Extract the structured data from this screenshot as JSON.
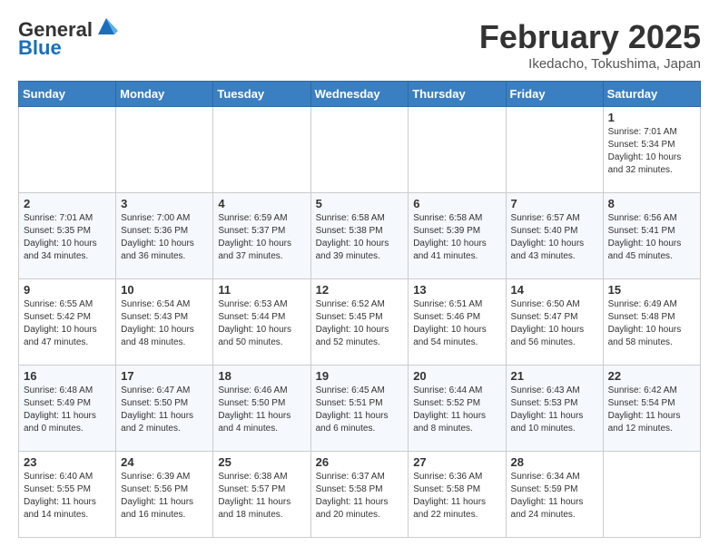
{
  "header": {
    "logo_general": "General",
    "logo_blue": "Blue",
    "month_title": "February 2025",
    "location": "Ikedacho, Tokushima, Japan"
  },
  "weekdays": [
    "Sunday",
    "Monday",
    "Tuesday",
    "Wednesday",
    "Thursday",
    "Friday",
    "Saturday"
  ],
  "weeks": [
    [
      {
        "day": "",
        "info": ""
      },
      {
        "day": "",
        "info": ""
      },
      {
        "day": "",
        "info": ""
      },
      {
        "day": "",
        "info": ""
      },
      {
        "day": "",
        "info": ""
      },
      {
        "day": "",
        "info": ""
      },
      {
        "day": "1",
        "info": "Sunrise: 7:01 AM\nSunset: 5:34 PM\nDaylight: 10 hours and 32 minutes."
      }
    ],
    [
      {
        "day": "2",
        "info": "Sunrise: 7:01 AM\nSunset: 5:35 PM\nDaylight: 10 hours and 34 minutes."
      },
      {
        "day": "3",
        "info": "Sunrise: 7:00 AM\nSunset: 5:36 PM\nDaylight: 10 hours and 36 minutes."
      },
      {
        "day": "4",
        "info": "Sunrise: 6:59 AM\nSunset: 5:37 PM\nDaylight: 10 hours and 37 minutes."
      },
      {
        "day": "5",
        "info": "Sunrise: 6:58 AM\nSunset: 5:38 PM\nDaylight: 10 hours and 39 minutes."
      },
      {
        "day": "6",
        "info": "Sunrise: 6:58 AM\nSunset: 5:39 PM\nDaylight: 10 hours and 41 minutes."
      },
      {
        "day": "7",
        "info": "Sunrise: 6:57 AM\nSunset: 5:40 PM\nDaylight: 10 hours and 43 minutes."
      },
      {
        "day": "8",
        "info": "Sunrise: 6:56 AM\nSunset: 5:41 PM\nDaylight: 10 hours and 45 minutes."
      }
    ],
    [
      {
        "day": "9",
        "info": "Sunrise: 6:55 AM\nSunset: 5:42 PM\nDaylight: 10 hours and 47 minutes."
      },
      {
        "day": "10",
        "info": "Sunrise: 6:54 AM\nSunset: 5:43 PM\nDaylight: 10 hours and 48 minutes."
      },
      {
        "day": "11",
        "info": "Sunrise: 6:53 AM\nSunset: 5:44 PM\nDaylight: 10 hours and 50 minutes."
      },
      {
        "day": "12",
        "info": "Sunrise: 6:52 AM\nSunset: 5:45 PM\nDaylight: 10 hours and 52 minutes."
      },
      {
        "day": "13",
        "info": "Sunrise: 6:51 AM\nSunset: 5:46 PM\nDaylight: 10 hours and 54 minutes."
      },
      {
        "day": "14",
        "info": "Sunrise: 6:50 AM\nSunset: 5:47 PM\nDaylight: 10 hours and 56 minutes."
      },
      {
        "day": "15",
        "info": "Sunrise: 6:49 AM\nSunset: 5:48 PM\nDaylight: 10 hours and 58 minutes."
      }
    ],
    [
      {
        "day": "16",
        "info": "Sunrise: 6:48 AM\nSunset: 5:49 PM\nDaylight: 11 hours and 0 minutes."
      },
      {
        "day": "17",
        "info": "Sunrise: 6:47 AM\nSunset: 5:50 PM\nDaylight: 11 hours and 2 minutes."
      },
      {
        "day": "18",
        "info": "Sunrise: 6:46 AM\nSunset: 5:50 PM\nDaylight: 11 hours and 4 minutes."
      },
      {
        "day": "19",
        "info": "Sunrise: 6:45 AM\nSunset: 5:51 PM\nDaylight: 11 hours and 6 minutes."
      },
      {
        "day": "20",
        "info": "Sunrise: 6:44 AM\nSunset: 5:52 PM\nDaylight: 11 hours and 8 minutes."
      },
      {
        "day": "21",
        "info": "Sunrise: 6:43 AM\nSunset: 5:53 PM\nDaylight: 11 hours and 10 minutes."
      },
      {
        "day": "22",
        "info": "Sunrise: 6:42 AM\nSunset: 5:54 PM\nDaylight: 11 hours and 12 minutes."
      }
    ],
    [
      {
        "day": "23",
        "info": "Sunrise: 6:40 AM\nSunset: 5:55 PM\nDaylight: 11 hours and 14 minutes."
      },
      {
        "day": "24",
        "info": "Sunrise: 6:39 AM\nSunset: 5:56 PM\nDaylight: 11 hours and 16 minutes."
      },
      {
        "day": "25",
        "info": "Sunrise: 6:38 AM\nSunset: 5:57 PM\nDaylight: 11 hours and 18 minutes."
      },
      {
        "day": "26",
        "info": "Sunrise: 6:37 AM\nSunset: 5:58 PM\nDaylight: 11 hours and 20 minutes."
      },
      {
        "day": "27",
        "info": "Sunrise: 6:36 AM\nSunset: 5:58 PM\nDaylight: 11 hours and 22 minutes."
      },
      {
        "day": "28",
        "info": "Sunrise: 6:34 AM\nSunset: 5:59 PM\nDaylight: 11 hours and 24 minutes."
      },
      {
        "day": "",
        "info": ""
      }
    ]
  ]
}
